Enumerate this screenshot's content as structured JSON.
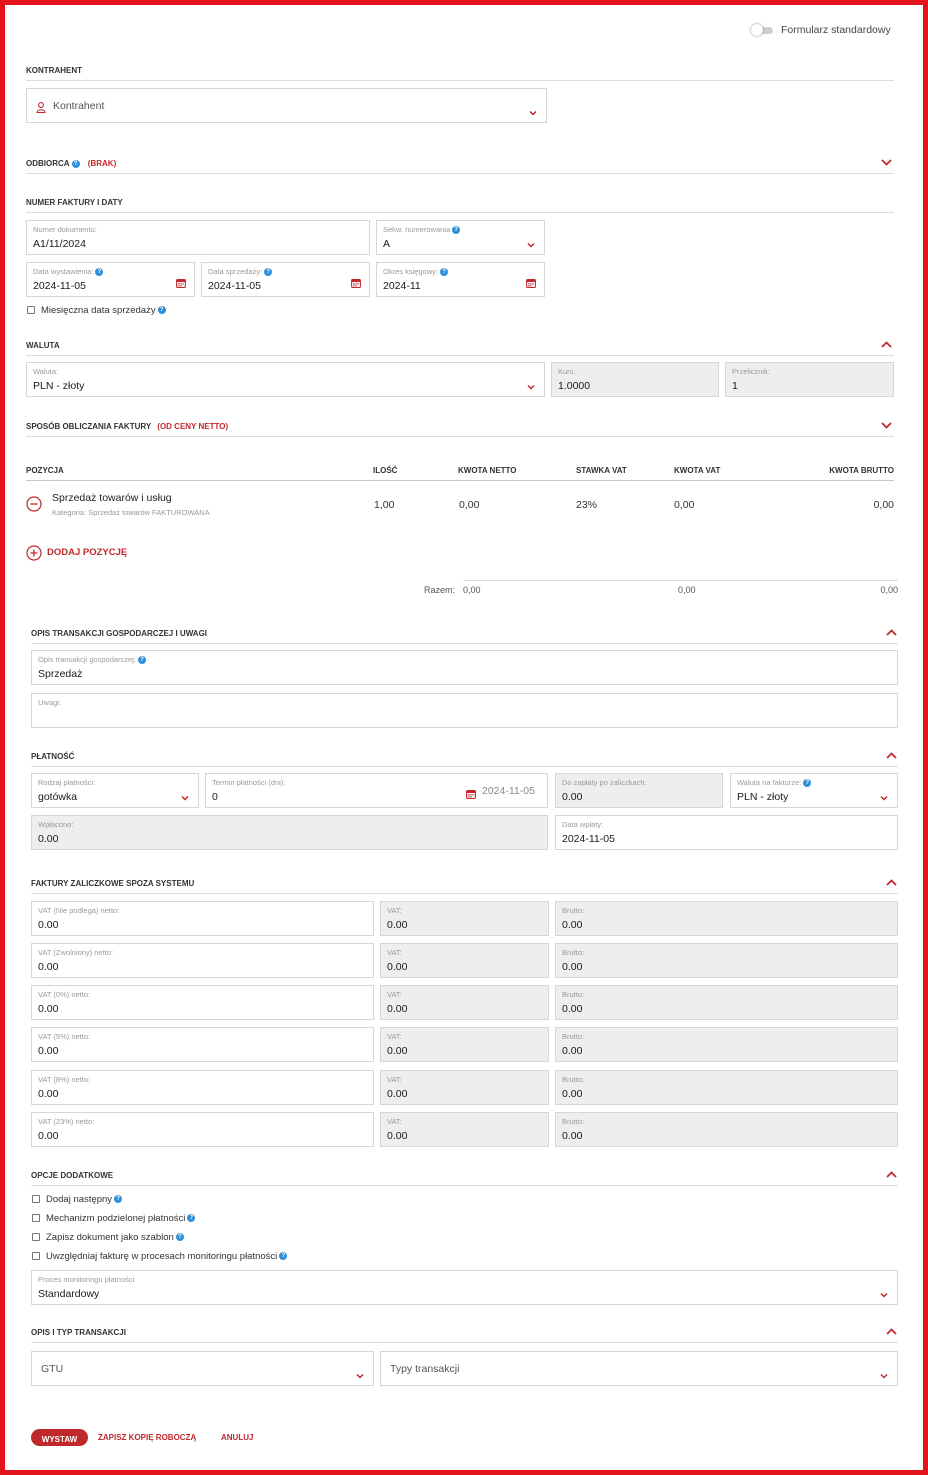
{
  "toggle": {
    "label": "Formularz standardowy"
  },
  "kontrahent": {
    "section": "KONTRAHENT",
    "placeholder": "Kontrahent"
  },
  "odbiorca": {
    "section": "ODBIORCA",
    "status": "(BRAK)"
  },
  "numer": {
    "section": "NUMER FAKTURY I DATY",
    "doc_label": "Numer dokumentu:",
    "doc_value": "A1/11/2024",
    "seq_label": "Sekw. numerowania",
    "seq_value": "A",
    "issue_label": "Data wystawienia:",
    "issue_value": "2024-11-05",
    "sale_label": "Data sprzedaży:",
    "sale_value": "2024-11-05",
    "period_label": "Okres księgowy:",
    "period_value": "2024-11",
    "monthly_label": "Miesięczna data sprzedaży"
  },
  "waluta": {
    "section": "WALUTA",
    "cur_label": "Waluta:",
    "cur_value": "PLN - złoty",
    "rate_label": "Kurs:",
    "rate_value": "1.0000",
    "conv_label": "Przelicznik:",
    "conv_value": "1"
  },
  "sposob": {
    "section": "SPOSÓB OBLICZANIA FAKTURY",
    "status": "(OD CENY NETTO)"
  },
  "table": {
    "headers": [
      "POZYCJA",
      "ILOŚĆ",
      "KWOTA NETTO",
      "STAWKA VAT",
      "KWOTA VAT",
      "KWOTA BRUTTO"
    ],
    "row": {
      "name": "Sprzedaż towarów i usług",
      "category": "Kategoria: Sprzedaż towarów FAKTUROWANA",
      "qty": "1,00",
      "net": "0,00",
      "vat_rate": "23%",
      "vat": "0,00",
      "gross": "0,00"
    },
    "add_label": "DODAJ POZYCJĘ",
    "sum_label": "Razem:",
    "sum_net": "0,00",
    "sum_vat": "0,00",
    "sum_gross": "0,00"
  },
  "opis": {
    "section": "OPIS TRANSAKCJI GOSPODARCZEJ I UWAGI",
    "desc_label": "Opis transakcji gospodarczej:",
    "desc_value": "Sprzedaż",
    "notes_label": "Uwagi:"
  },
  "platnosc": {
    "section": "PŁATNOŚĆ",
    "type_label": "Rodzaj płatności:",
    "type_value": "gotówka",
    "term_label": "Termin płatności (dni):",
    "term_value": "0",
    "term_date": "2024-11-05",
    "topay_label": "Do zapłaty po zaliczkach:",
    "topay_value": "0.00",
    "invcur_label": "Waluta na fakturze:",
    "invcur_value": "PLN - złoty",
    "paid_label": "Wpłacono:",
    "paid_value": "0.00",
    "paydate_label": "Data wpłaty:",
    "paydate_value": "2024-11-05"
  },
  "zaliczki": {
    "section": "FAKTURY ZALICZKOWE SPOZA SYSTEMU",
    "rows": [
      {
        "net_label": "VAT (Nie podlega) netto:",
        "net": "0.00",
        "vat_label": "VAT:",
        "vat": "0.00",
        "gross_label": "Brutto:",
        "gross": "0.00"
      },
      {
        "net_label": "VAT (Zwolniony) netto:",
        "net": "0.00",
        "vat_label": "VAT:",
        "vat": "0.00",
        "gross_label": "Brutto:",
        "gross": "0.00"
      },
      {
        "net_label": "VAT (0%) netto:",
        "net": "0.00",
        "vat_label": "VAT:",
        "vat": "0.00",
        "gross_label": "Brutto:",
        "gross": "0.00"
      },
      {
        "net_label": "VAT (5%) netto:",
        "net": "0.00",
        "vat_label": "VAT:",
        "vat": "0.00",
        "gross_label": "Brutto:",
        "gross": "0.00"
      },
      {
        "net_label": "VAT (8%) netto:",
        "net": "0.00",
        "vat_label": "VAT:",
        "vat": "0.00",
        "gross_label": "Brutto:",
        "gross": "0.00"
      },
      {
        "net_label": "VAT (23%) netto:",
        "net": "0.00",
        "vat_label": "VAT:",
        "vat": "0.00",
        "gross_label": "Brutto:",
        "gross": "0.00"
      }
    ]
  },
  "opcje": {
    "section": "OPCJE DODATKOWE",
    "items": [
      "Dodaj następny",
      "Mechanizm podzielonej płatności",
      "Zapisz dokument jako szablon",
      "Uwzględniaj fakturę w procesach monitoringu płatności"
    ],
    "process_label": "Proces monitoringu płatności",
    "process_value": "Standardowy"
  },
  "typ": {
    "section": "OPIS I TYP TRANSAKCJI",
    "gtu_placeholder": "GTU",
    "types_placeholder": "Typy transakcji"
  },
  "actions": {
    "issue": "WYSTAW",
    "draft": "ZAPISZ KOPIĘ ROBOCZĄ",
    "cancel": "ANULUJ"
  },
  "colors": {
    "accent": "#c0282c",
    "help": "#2f8fd8",
    "frame": "#e3141b"
  }
}
